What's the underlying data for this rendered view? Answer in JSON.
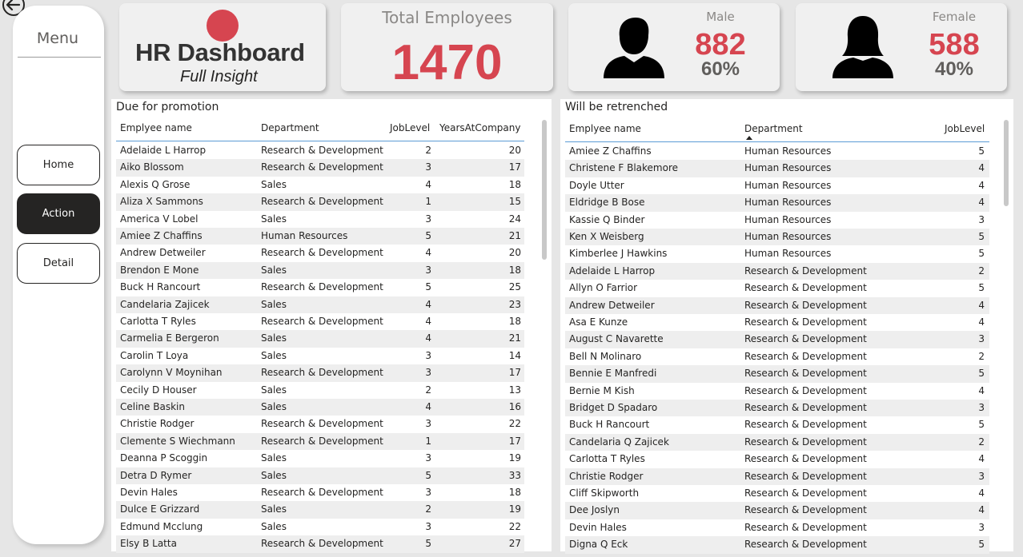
{
  "sidebar": {
    "title": "Menu",
    "items": [
      {
        "label": "Home",
        "active": false
      },
      {
        "label": "Action",
        "active": true
      },
      {
        "label": "Detail",
        "active": false
      }
    ]
  },
  "logo": {
    "title": "HR Dashboard",
    "subtitle": "Full Insight",
    "dot_color": "#d64550"
  },
  "kpis": {
    "total": {
      "label": "Total Employees",
      "value": "1470"
    },
    "male": {
      "label": "Male",
      "value": "882",
      "pct": "60%"
    },
    "female": {
      "label": "Female",
      "value": "588",
      "pct": "40%"
    }
  },
  "accent_color": "#d64550",
  "promotion": {
    "title": "Due for promotion",
    "columns": [
      "Emplyee name",
      "Department",
      "JobLevel",
      "YearsAtCompany"
    ],
    "rows": [
      [
        "Adelaide L Harrop",
        "Research & Development",
        "2",
        "20"
      ],
      [
        "Aiko Blossom",
        "Research & Development",
        "3",
        "17"
      ],
      [
        "Alexis Q Grose",
        "Sales",
        "4",
        "18"
      ],
      [
        "Aliza X Sammons",
        "Research & Development",
        "1",
        "15"
      ],
      [
        "America V Lobel",
        "Sales",
        "3",
        "24"
      ],
      [
        "Amiee Z Chaffins",
        "Human Resources",
        "5",
        "21"
      ],
      [
        "Andrew Detweiler",
        "Research & Development",
        "4",
        "20"
      ],
      [
        "Brendon E Mone",
        "Sales",
        "3",
        "18"
      ],
      [
        "Buck H Rancourt",
        "Research & Development",
        "5",
        "25"
      ],
      [
        "Candelaria Zajicek",
        "Sales",
        "4",
        "23"
      ],
      [
        "Carlotta T Ryles",
        "Research & Development",
        "4",
        "18"
      ],
      [
        "Carmelia E Bergeron",
        "Sales",
        "4",
        "21"
      ],
      [
        "Carolin T Loya",
        "Sales",
        "3",
        "14"
      ],
      [
        "Carolynn V Moynihan",
        "Research & Development",
        "3",
        "17"
      ],
      [
        "Cecily D Houser",
        "Sales",
        "2",
        "13"
      ],
      [
        "Celine Baskin",
        "Sales",
        "4",
        "16"
      ],
      [
        "Christie Rodger",
        "Research & Development",
        "3",
        "22"
      ],
      [
        "Clemente S Wiechmann",
        "Research & Development",
        "1",
        "17"
      ],
      [
        "Deanna P Scoggin",
        "Sales",
        "3",
        "19"
      ],
      [
        "Detra D Rymer",
        "Sales",
        "5",
        "33"
      ],
      [
        "Devin Hales",
        "Research & Development",
        "3",
        "18"
      ],
      [
        "Dulce E Grizzard",
        "Sales",
        "2",
        "19"
      ],
      [
        "Edmund Mcclung",
        "Sales",
        "3",
        "22"
      ],
      [
        "Elsy B Latta",
        "Research & Development",
        "5",
        "27"
      ]
    ]
  },
  "retrench": {
    "title": "Will be retrenched",
    "columns": [
      "Emplyee name",
      "Department",
      "JobLevel"
    ],
    "rows": [
      [
        "Amiee Z Chaffins",
        "Human Resources",
        "5"
      ],
      [
        "Christene F Blakemore",
        "Human Resources",
        "4"
      ],
      [
        "Doyle Utter",
        "Human Resources",
        "4"
      ],
      [
        "Eldridge B Bose",
        "Human Resources",
        "4"
      ],
      [
        "Kassie Q Binder",
        "Human Resources",
        "3"
      ],
      [
        "Ken X Weisberg",
        "Human Resources",
        "5"
      ],
      [
        "Kimberlee J Hawkins",
        "Human Resources",
        "5"
      ],
      [
        "Adelaide L Harrop",
        "Research & Development",
        "2"
      ],
      [
        "Allyn O Farrior",
        "Research & Development",
        "5"
      ],
      [
        "Andrew Detweiler",
        "Research & Development",
        "4"
      ],
      [
        "Asa E Kunze",
        "Research & Development",
        "4"
      ],
      [
        "August C Navarette",
        "Research & Development",
        "3"
      ],
      [
        "Bell N Molinaro",
        "Research & Development",
        "2"
      ],
      [
        "Bennie E Manfredi",
        "Research & Development",
        "5"
      ],
      [
        "Bernie M Kish",
        "Research & Development",
        "4"
      ],
      [
        "Bridget D Spadaro",
        "Research & Development",
        "3"
      ],
      [
        "Buck H Rancourt",
        "Research & Development",
        "5"
      ],
      [
        "Candelaria Q Zajicek",
        "Research & Development",
        "2"
      ],
      [
        "Carlotta T Ryles",
        "Research & Development",
        "4"
      ],
      [
        "Christie Rodger",
        "Research & Development",
        "3"
      ],
      [
        "Cliff Skipworth",
        "Research & Development",
        "4"
      ],
      [
        "Dee Joslyn",
        "Research & Development",
        "4"
      ],
      [
        "Devin Hales",
        "Research & Development",
        "3"
      ],
      [
        "Digna Q Eck",
        "Research & Development",
        "5"
      ]
    ]
  }
}
